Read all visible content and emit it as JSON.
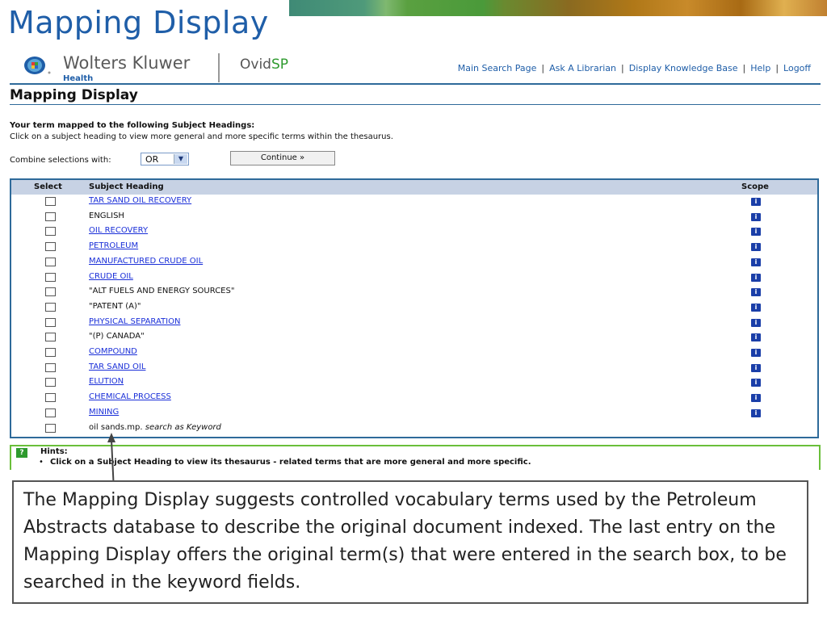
{
  "slide": {
    "title": "Mapping Display"
  },
  "header": {
    "brand": "Wolters Kluwer",
    "brand_sub": "Health",
    "product": "Ovid",
    "product_sp": "SP",
    "nav": [
      "Main Search Page",
      "Ask A Librarian",
      "Display Knowledge Base",
      "Help",
      "Logoff"
    ]
  },
  "page": {
    "title": "Mapping Display",
    "intro_bold": "Your term mapped to the following Subject Headings:",
    "intro": "Click on a subject heading to view more general and more specific terms within the thesaurus.",
    "combine_label": "Combine selections with:",
    "combine_value": "OR",
    "continue_label": "Continue »"
  },
  "table": {
    "headers": {
      "select": "Select",
      "subject": "Subject Heading",
      "scope": "Scope"
    },
    "rows": [
      {
        "subject": "TAR SAND OIL RECOVERY",
        "link": true,
        "scope": true
      },
      {
        "subject": "ENGLISH",
        "link": false,
        "scope": true
      },
      {
        "subject": "OIL RECOVERY",
        "link": true,
        "scope": true
      },
      {
        "subject": "PETROLEUM",
        "link": true,
        "scope": true
      },
      {
        "subject": "MANUFACTURED CRUDE OIL",
        "link": true,
        "scope": true
      },
      {
        "subject": "CRUDE OIL",
        "link": true,
        "scope": true
      },
      {
        "subject": "\"ALT FUELS AND ENERGY SOURCES\"",
        "link": false,
        "scope": true
      },
      {
        "subject": "\"PATENT (A)\"",
        "link": false,
        "scope": true
      },
      {
        "subject": "PHYSICAL SEPARATION",
        "link": true,
        "scope": true
      },
      {
        "subject": "\"(P) CANADA\"",
        "link": false,
        "scope": true
      },
      {
        "subject": "COMPOUND",
        "link": true,
        "scope": true
      },
      {
        "subject": "TAR SAND OIL",
        "link": true,
        "scope": true
      },
      {
        "subject": "ELUTION",
        "link": true,
        "scope": true
      },
      {
        "subject": "CHEMICAL PROCESS",
        "link": true,
        "scope": true
      },
      {
        "subject": "MINING",
        "link": true,
        "scope": true
      }
    ],
    "keyword_row": {
      "term": "oil sands.mp.",
      "suffix": "search as Keyword"
    },
    "scope_icon": "i"
  },
  "hints": {
    "icon": "?",
    "label": "Hints:",
    "items": [
      "Click on a Subject Heading to view its thesaurus - related terms that are more general and more specific."
    ]
  },
  "callout": {
    "text": "The Mapping Display suggests controlled vocabulary terms used by the Petroleum Abstracts database to describe the original document indexed. The last entry on the Mapping Display offers the original term(s) that were entered in the search box, to be searched in the keyword fields."
  }
}
